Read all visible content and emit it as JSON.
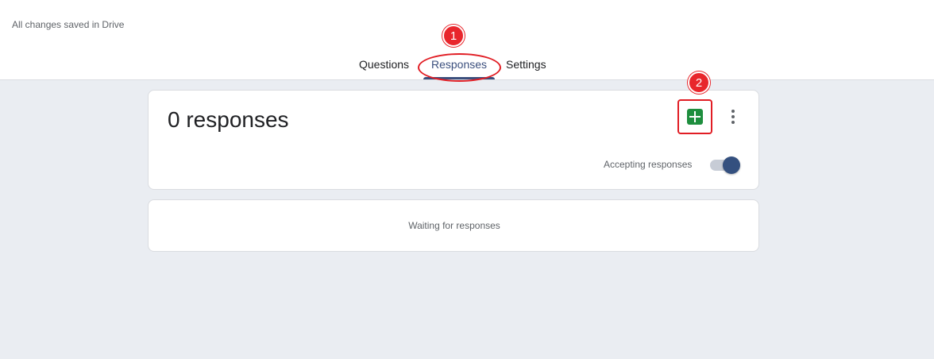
{
  "header": {
    "save_status": "All changes saved in Drive"
  },
  "tabs": [
    {
      "label": "Questions",
      "active": false
    },
    {
      "label": "Responses",
      "active": true
    },
    {
      "label": "Settings",
      "active": false
    }
  ],
  "annotations": {
    "badge1": "1",
    "badge2": "2",
    "color": "#e8262c"
  },
  "summary": {
    "response_count": "0 responses",
    "sheets_icon": "google-sheets-icon",
    "more_icon": "more-vert-icon",
    "accepting_label": "Accepting responses",
    "accepting_enabled": true
  },
  "waiting": {
    "text": "Waiting for responses"
  },
  "colors": {
    "accent": "#3b4f7d",
    "sheets_green": "#1e8e3e",
    "background": "#eaedf2"
  }
}
